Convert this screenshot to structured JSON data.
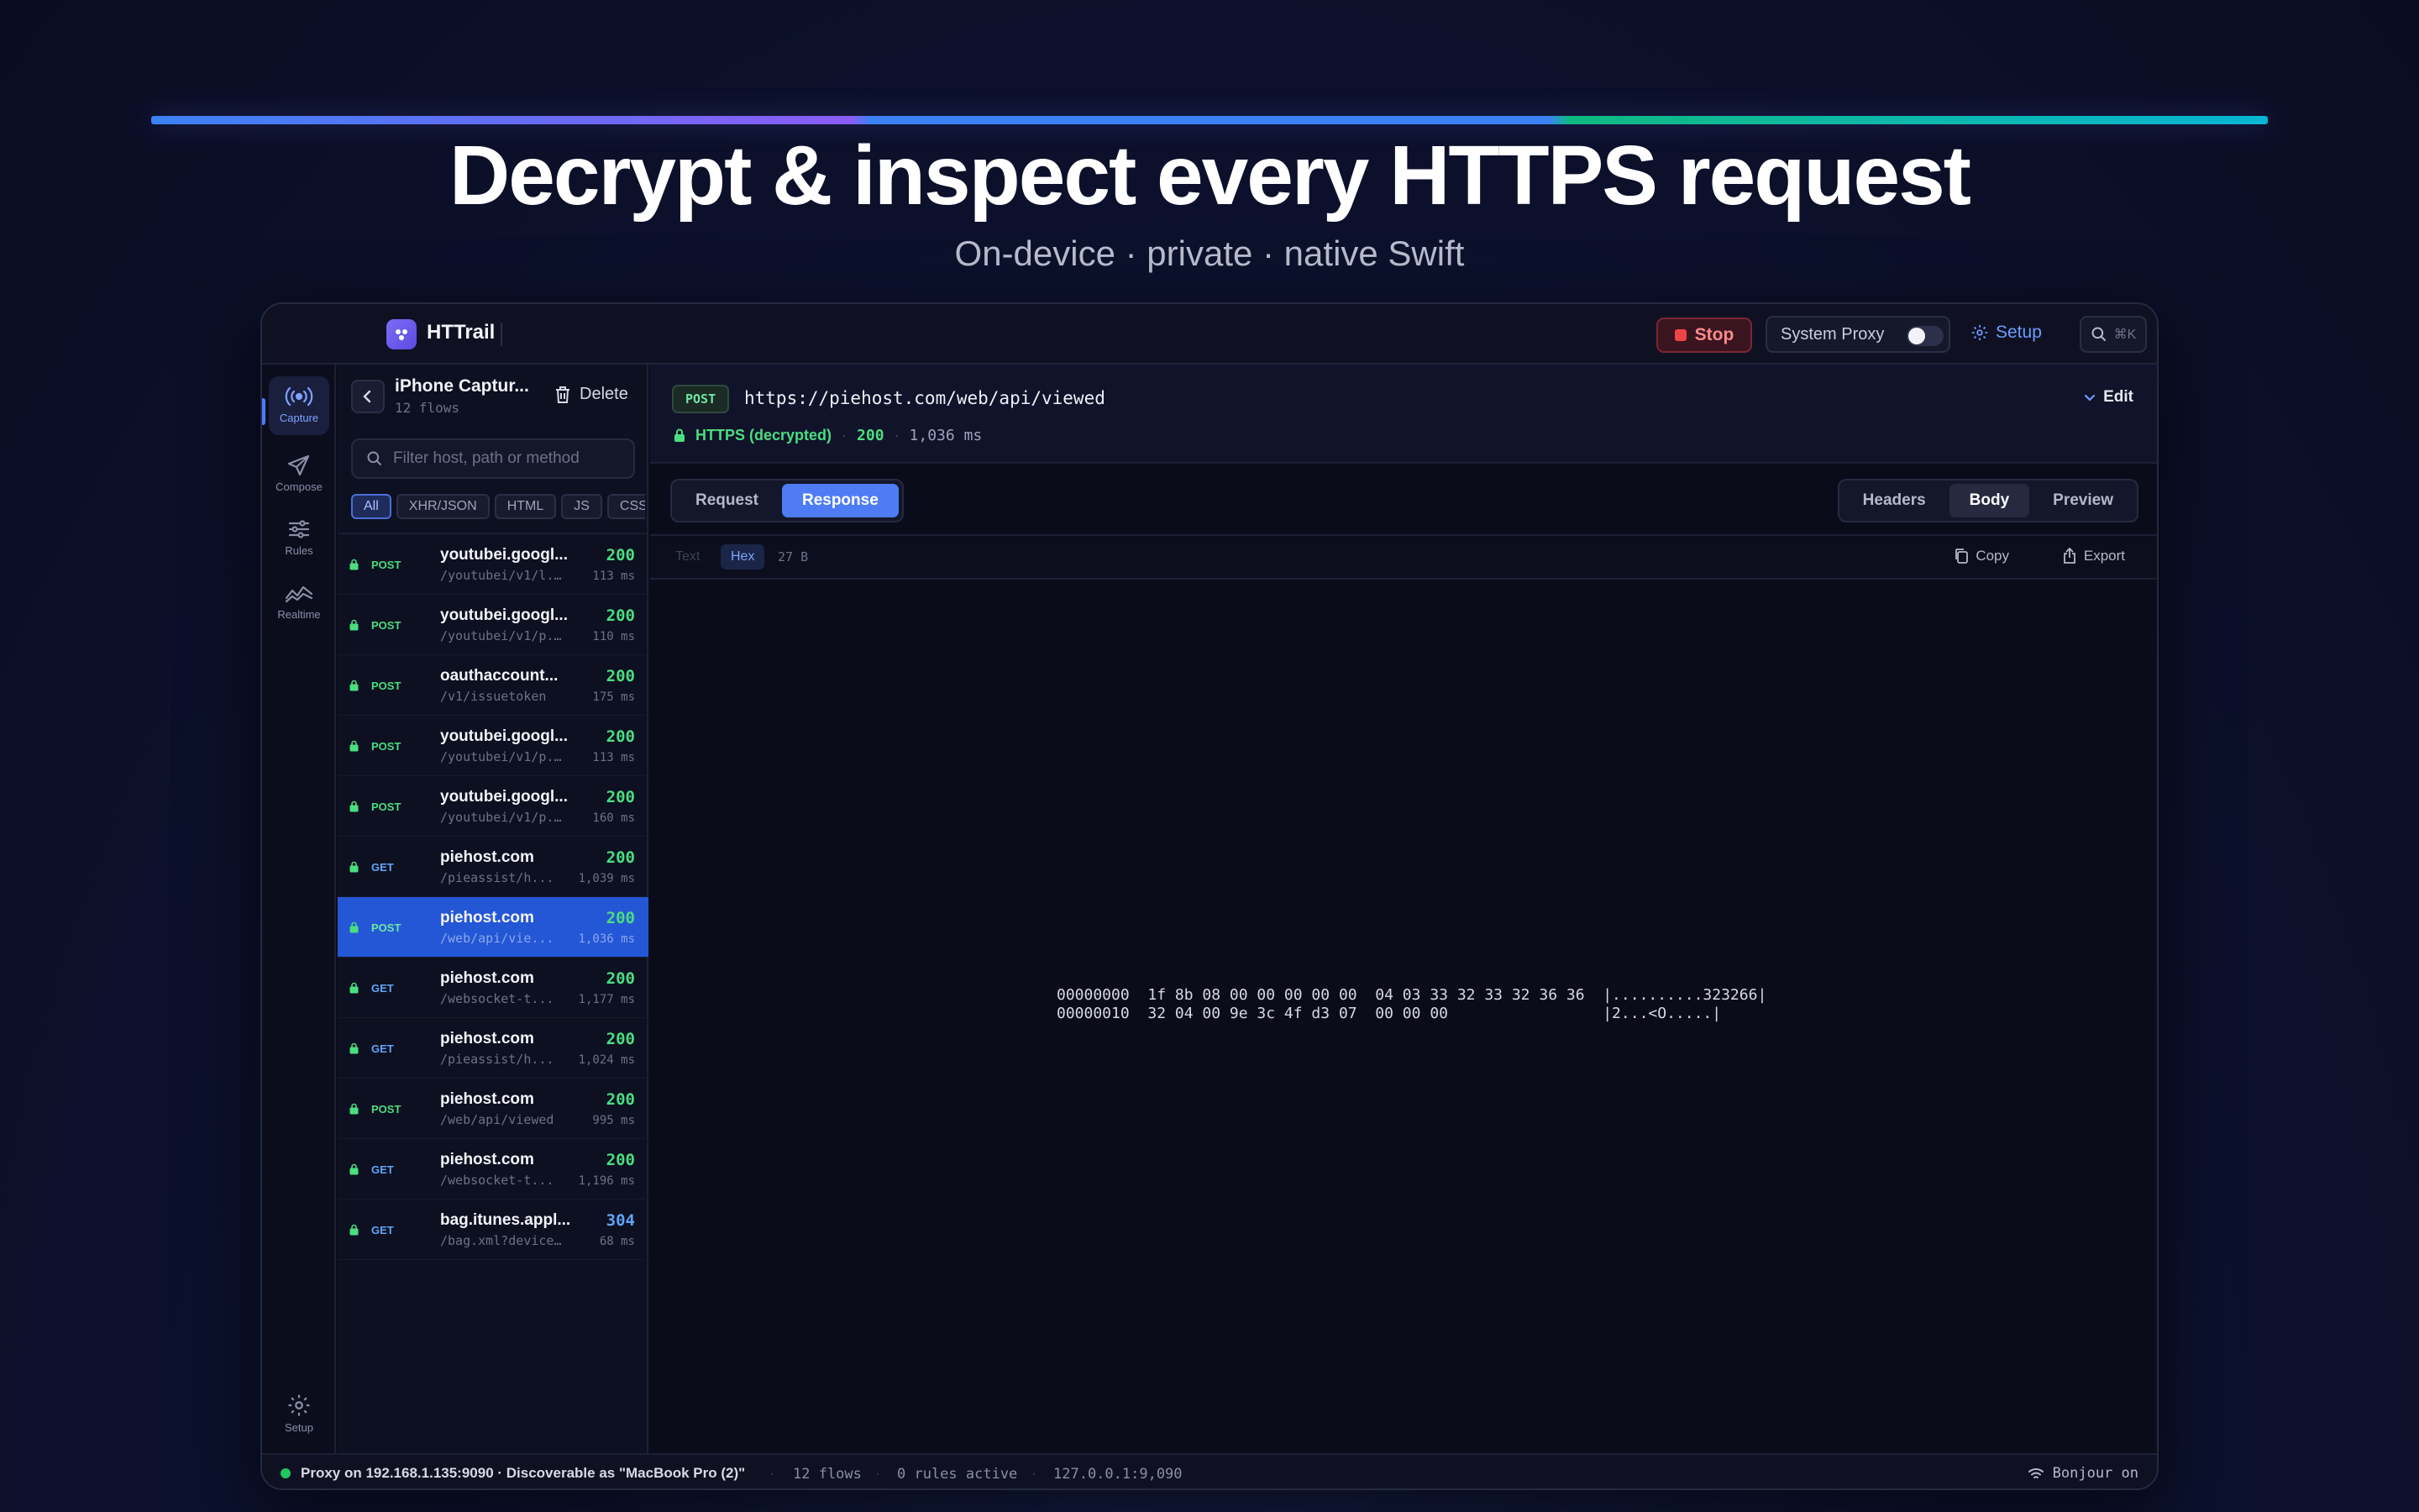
{
  "hero": {
    "title": "Decrypt & inspect every HTTPS request",
    "subtitle": "On-device · private · native Swift"
  },
  "app": {
    "name": "HTTrail",
    "stop_label": "Stop",
    "system_proxy_label": "System Proxy",
    "system_proxy_enabled": false,
    "setup_label": "Setup",
    "search_shortcut": "⌘K"
  },
  "rail": {
    "items": [
      {
        "label": "Capture",
        "icon": "capture-icon",
        "active": true
      },
      {
        "label": "Compose",
        "icon": "paper-plane-icon",
        "active": false
      },
      {
        "label": "Rules",
        "icon": "sliders-icon",
        "active": false
      },
      {
        "label": "Realtime",
        "icon": "waveform-icon",
        "active": false
      }
    ],
    "setup_label": "Setup"
  },
  "capture": {
    "title": "iPhone Captur...",
    "subtitle": "12 flows",
    "delete_label": "Delete",
    "filter_placeholder": "Filter host, path or method",
    "chips": [
      "All",
      "XHR/JSON",
      "HTML",
      "JS",
      "CSS"
    ],
    "active_chip": "All"
  },
  "flows": [
    {
      "method": "POST",
      "host": "youtubei.googl...",
      "path": "/youtubei/v1/l...",
      "status": "200",
      "time": "113 ms"
    },
    {
      "method": "POST",
      "host": "youtubei.googl...",
      "path": "/youtubei/v1/p...",
      "status": "200",
      "time": "110 ms"
    },
    {
      "method": "POST",
      "host": "oauthaccount...",
      "path": "/v1/issuetoken",
      "status": "200",
      "time": "175 ms"
    },
    {
      "method": "POST",
      "host": "youtubei.googl...",
      "path": "/youtubei/v1/p...",
      "status": "200",
      "time": "113 ms"
    },
    {
      "method": "POST",
      "host": "youtubei.googl...",
      "path": "/youtubei/v1/p...",
      "status": "200",
      "time": "160 ms"
    },
    {
      "method": "GET",
      "host": "piehost.com",
      "path": "/pieassist/h...",
      "status": "200",
      "time": "1,039 ms"
    },
    {
      "method": "POST",
      "host": "piehost.com",
      "path": "/web/api/vie...",
      "status": "200",
      "time": "1,036 ms",
      "selected": true
    },
    {
      "method": "GET",
      "host": "piehost.com",
      "path": "/websocket-t...",
      "status": "200",
      "time": "1,177 ms"
    },
    {
      "method": "GET",
      "host": "piehost.com",
      "path": "/pieassist/h...",
      "status": "200",
      "time": "1,024 ms"
    },
    {
      "method": "POST",
      "host": "piehost.com",
      "path": "/web/api/viewed",
      "status": "200",
      "time": "995 ms"
    },
    {
      "method": "GET",
      "host": "piehost.com",
      "path": "/websocket-t...",
      "status": "200",
      "time": "1,196 ms"
    },
    {
      "method": "GET",
      "host": "bag.itunes.appl...",
      "path": "/bag.xml?device...",
      "status": "304",
      "time": "68 ms"
    }
  ],
  "detail": {
    "method": "POST",
    "url": "https://piehost.com/web/api/viewed",
    "edit_label": "Edit",
    "security": "HTTPS (decrypted)",
    "status": "200",
    "duration": "1,036 ms",
    "dir_tabs": [
      "Request",
      "Response"
    ],
    "active_dir": "Response",
    "view_tabs": [
      "Headers",
      "Body",
      "Preview"
    ],
    "active_view": "Body",
    "body_text_label": "Text",
    "body_hex_label": "Hex",
    "body_size": "27 B",
    "copy_label": "Copy",
    "export_label": "Export",
    "hex_lines": [
      "00000000  1f 8b 08 00 00 00 00 00  04 03 33 32 33 32 36 36  |..........323266|",
      "00000010  32 04 00 9e 3c 4f d3 07  00 00 00                 |2...<O.....|"
    ]
  },
  "statusbar": {
    "proxy": "Proxy on 192.168.1.135:9090 · Discoverable as \"MacBook Pro (2)\"",
    "flows": "12 flows",
    "rules": "0 rules active",
    "address": "127.0.0.1:9,090",
    "bonjour": "Bonjour on"
  },
  "colors": {
    "accent": "#4d7cf5",
    "success": "#4ade80",
    "danger": "#ef4444",
    "background": "#0a0c1a"
  }
}
